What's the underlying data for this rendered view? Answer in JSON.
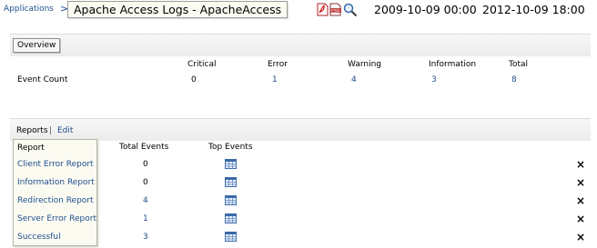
{
  "header": {
    "breadcrumb_link": "Applications",
    "breadcrumb_separator": ">",
    "title": "Apache Access Logs - ApacheAccess",
    "icons": [
      "pdf-icon",
      "csv-icon",
      "search-icon"
    ],
    "date_from": "2009-10-09 00:00",
    "date_to": "2012-10-09 18:00"
  },
  "overview": {
    "tab_label": "Overview",
    "columns": [
      "Critical",
      "Error",
      "Warning",
      "Information",
      "Total"
    ],
    "row_label": "Event Count",
    "values": [
      "0",
      "1",
      "4",
      "3",
      "8"
    ]
  },
  "reports": {
    "title": "Reports",
    "separator": "|",
    "edit_label": "Edit",
    "columns": [
      "Report",
      "Total Events",
      "Top Events"
    ],
    "rows": [
      {
        "name": "Client Error Report",
        "total": "0"
      },
      {
        "name": "Information Report",
        "total": "0"
      },
      {
        "name": "Redirection Report",
        "total": "4"
      },
      {
        "name": "Server Error Report",
        "total": "1"
      },
      {
        "name": "Successful",
        "total": "3"
      }
    ],
    "close_glyph": "×"
  },
  "colors": {
    "link": "#1f4e8c",
    "panel_bar": "#ececec",
    "title_box_bg": "#fbfbf2"
  }
}
